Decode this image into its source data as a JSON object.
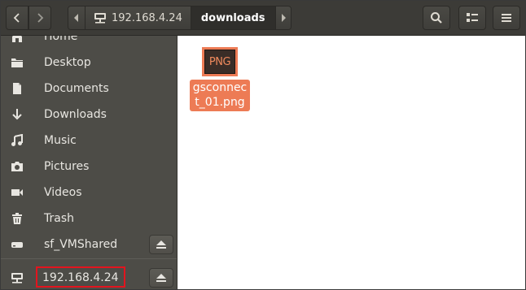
{
  "header": {
    "path": [
      "192.168.4.24",
      "downloads"
    ],
    "icons": {
      "back": "chevron-left-icon",
      "forward": "chevron-right-icon",
      "search": "search-icon",
      "view": "view-options-icon",
      "menu": "hamburger-menu-icon"
    }
  },
  "sidebar": {
    "items": [
      {
        "label": "Home",
        "icon": "home-icon"
      },
      {
        "label": "Desktop",
        "icon": "folder-icon"
      },
      {
        "label": "Documents",
        "icon": "document-icon"
      },
      {
        "label": "Downloads",
        "icon": "download-icon"
      },
      {
        "label": "Music",
        "icon": "music-icon"
      },
      {
        "label": "Pictures",
        "icon": "camera-icon"
      },
      {
        "label": "Videos",
        "icon": "video-icon"
      },
      {
        "label": "Trash",
        "icon": "trash-icon"
      },
      {
        "label": "sf_VMShared",
        "icon": "drive-icon"
      },
      {
        "label": "192.168.4.24",
        "icon": "network-share-icon"
      }
    ]
  },
  "content": {
    "files": [
      {
        "name": "gsconnect_01.png",
        "thumb_text": "PNG"
      }
    ]
  },
  "colors": {
    "headerbar": "#3c3b37",
    "sidebar": "#4d4c47",
    "selection": "#ed7b55",
    "annotation_box": "#e3141e"
  }
}
